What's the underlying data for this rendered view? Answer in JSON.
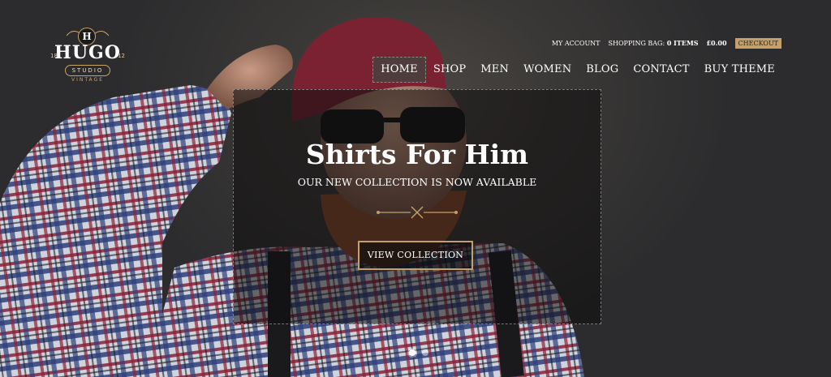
{
  "logo": {
    "badge_letter": "H",
    "brand": "HUGO",
    "num_left": "18",
    "num_right": "12",
    "studio": "STUDIO",
    "vintage": "VINTAGE"
  },
  "topbar": {
    "account": "MY ACCOUNT",
    "bag_label": "SHOPPING BAG:",
    "bag_count": "0 ITEMS",
    "price": "£0.00",
    "checkout": "CHECKOUT"
  },
  "nav": {
    "items": [
      "HOME",
      "SHOP",
      "MEN",
      "WOMEN",
      "BLOG",
      "CONTACT",
      "BUY THEME"
    ],
    "active_index": 0
  },
  "slide": {
    "title": "Shirts For Him",
    "subtitle": "OUR NEW COLLECTION IS NOW AVAILABLE",
    "cta": "VIEW COLLECTION"
  },
  "pager": {
    "count": 2,
    "active": 0
  },
  "colors": {
    "accent": "#c4a06a",
    "background": "#2b2b2d"
  }
}
